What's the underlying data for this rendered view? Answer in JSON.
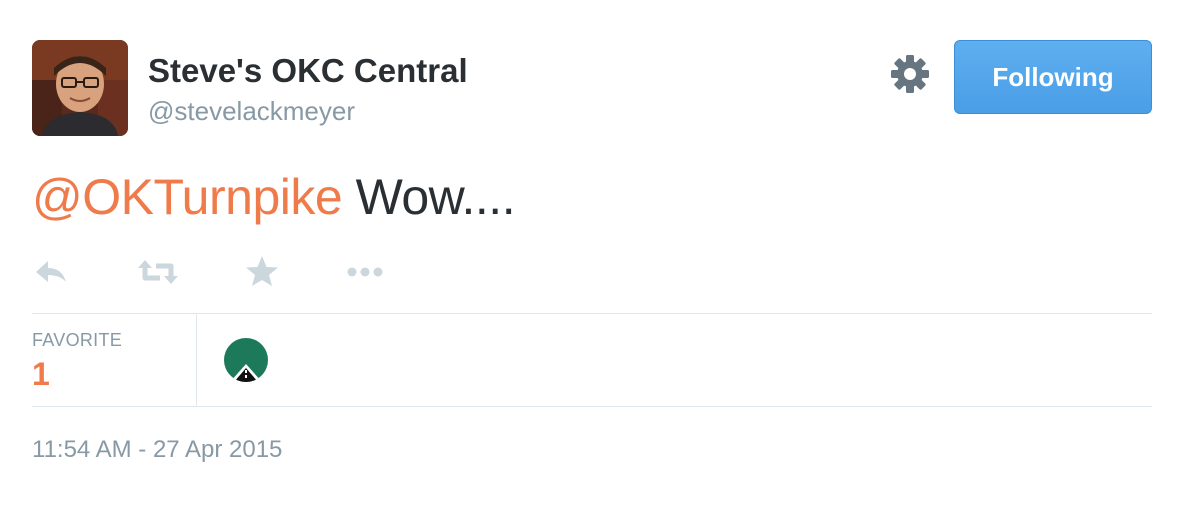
{
  "author": {
    "name": "Steve's OKC Central",
    "handle": "@stevelackmeyer",
    "avatar_icon": "profile-photo"
  },
  "follow_button": {
    "label": "Following",
    "color": "#55acee"
  },
  "settings": {
    "icon": "gear-icon"
  },
  "tweet": {
    "mention": "@OKTurnpike",
    "text": " Wow...."
  },
  "actions": [
    {
      "name": "reply",
      "icon": "reply-icon"
    },
    {
      "name": "retweet",
      "icon": "retweet-icon"
    },
    {
      "name": "favorite",
      "icon": "star-icon"
    },
    {
      "name": "more",
      "icon": "more-icon"
    }
  ],
  "stats": {
    "favorites_label": "FAVORITE",
    "favorites_count": "1"
  },
  "favoriters": [
    {
      "name": "OKTurnpike",
      "icon": "turnpike-logo-avatar",
      "color": "#1c7a5a"
    }
  ],
  "timestamp": "11:54 AM - 27 Apr 2015",
  "colors": {
    "accent": "#ef7b4b",
    "text": "#292f33",
    "muted": "#8899a6",
    "icon": "#ccd6dd",
    "divider": "#e1e8ed"
  }
}
